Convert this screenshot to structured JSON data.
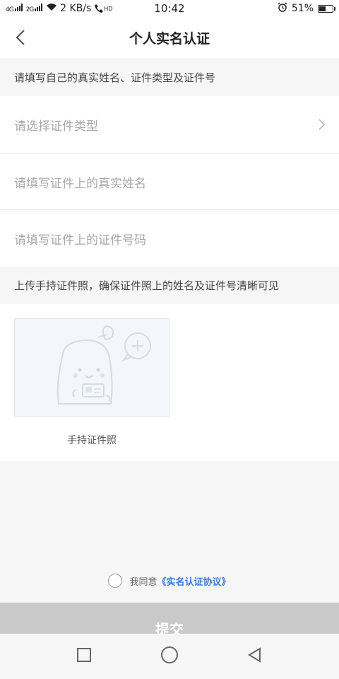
{
  "status_bar": {
    "network_speed": "2 KB/s",
    "time": "10:42",
    "battery_percent": "51%",
    "battery_level": 0.51,
    "sig1_label": "4G",
    "sig2_label": "2G",
    "hd_label": "HD"
  },
  "header": {
    "title": "个人实名认证"
  },
  "form": {
    "section_hint": "请填写自己的真实姓名、证件类型及证件号",
    "id_type_placeholder": "请选择证件类型",
    "name_placeholder": "请填写证件上的真实姓名",
    "id_number_placeholder": "请填写证件上的证件号码"
  },
  "upload": {
    "section_hint": "上传手持证件照，确保证件照上的姓名及证件号清晰可见",
    "photo_label": "手持证件照"
  },
  "agreement": {
    "prefix": "我同意",
    "link": "《实名认证协议》"
  },
  "actions": {
    "submit_label": "提交"
  },
  "colors": {
    "link": "#3c7bd8",
    "submit_disabled": "#c9c9c9"
  }
}
